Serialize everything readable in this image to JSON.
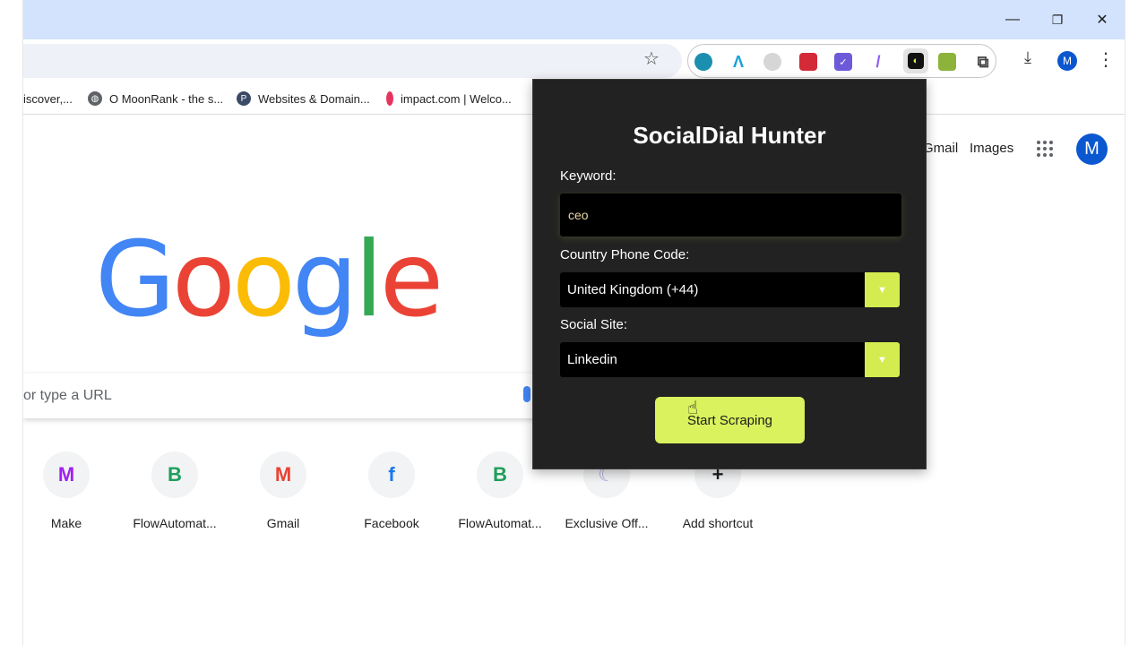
{
  "browser": {
    "window_controls": {
      "minimize": "—",
      "restore": "❐",
      "close": "✕"
    },
    "avatar_initial": "M",
    "bookmarks": [
      {
        "label": "iscover,...",
        "icon": "globe-icon",
        "color": "#888888"
      },
      {
        "label": "O MoonRank - the s...",
        "icon": "globe-icon",
        "color": "#5f6368"
      },
      {
        "label": "Websites & Domain...",
        "icon": "p-logo-icon",
        "color": "#3b4a66"
      },
      {
        "label": "impact.com | Welco...",
        "icon": "impact-icon",
        "color": "#e5355f"
      }
    ],
    "extensions": [
      {
        "icon": "globe-ext-icon",
        "color": "#1a8fb0"
      },
      {
        "icon": "a-ext-icon",
        "color": "#18a0d8"
      },
      {
        "icon": "link-ext-icon",
        "color": "#b0b0b0"
      },
      {
        "icon": "shield-ext-icon",
        "color": "#d42a37"
      },
      {
        "icon": "check-ext-icon",
        "color": "#6c5ad8"
      },
      {
        "icon": "pen-ext-icon",
        "color": "#8b5cf6"
      },
      {
        "icon": "socialdial-ext-icon",
        "color": "#111111"
      },
      {
        "icon": "sheet-ext-icon",
        "color": "#8db33a"
      },
      {
        "icon": "puzzle-icon",
        "color": "#444444"
      }
    ]
  },
  "google": {
    "links": {
      "gmail": "Gmail",
      "images": "Images"
    },
    "logo_letters": [
      {
        "ch": "G",
        "color": "#4285f4"
      },
      {
        "ch": "o",
        "color": "#ea4335"
      },
      {
        "ch": "o",
        "color": "#fbbc05"
      },
      {
        "ch": "g",
        "color": "#4285f4"
      },
      {
        "ch": "l",
        "color": "#34a853"
      },
      {
        "ch": "e",
        "color": "#ea4335"
      }
    ],
    "search_placeholder": "or type a URL",
    "shortcuts": [
      {
        "label": "Make",
        "glyph": "M",
        "color": "#a020f0"
      },
      {
        "label": "FlowAutomat...",
        "glyph": "B",
        "color": "#1e9e5a"
      },
      {
        "label": "Gmail",
        "glyph": "M",
        "color": "#ea4335"
      },
      {
        "label": "Facebook",
        "glyph": "f",
        "color": "#1877f2"
      },
      {
        "label": "FlowAutomat...",
        "glyph": "B",
        "color": "#1e9e5a"
      },
      {
        "label": "Exclusive Off...",
        "glyph": "☾",
        "color": "#b6a7e0"
      },
      {
        "label": "Add shortcut",
        "glyph": "+",
        "color": "#1f1f1f"
      }
    ]
  },
  "popup": {
    "title": "SocialDial Hunter",
    "keyword_label": "Keyword:",
    "keyword_value": "ceo",
    "country_label": "Country Phone Code:",
    "country_value": "United Kingdom (+44)",
    "site_label": "Social Site:",
    "site_value": "Linkedin",
    "button_label": "Start Scraping",
    "accent": "#d9f25e"
  }
}
